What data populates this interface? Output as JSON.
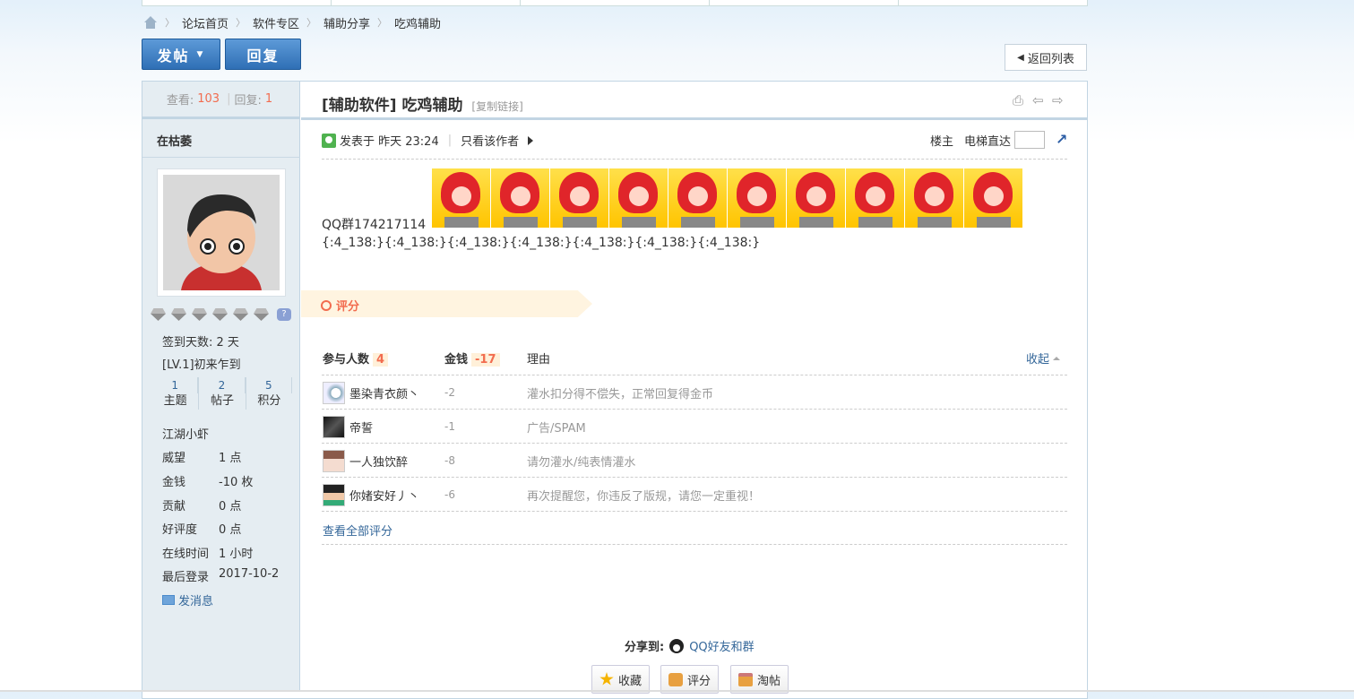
{
  "breadcrumb": [
    "论坛首页",
    "软件专区",
    "辅助分享",
    "吃鸡辅助"
  ],
  "toolbar": {
    "post_label": "发帖",
    "reply_label": "回复",
    "back_label": "返回列表"
  },
  "stats": {
    "views_label": "查看:",
    "views": "103",
    "replies_label": "回复:",
    "replies": "1",
    "divider": "|"
  },
  "user": {
    "name": "在枯萎",
    "signin": "签到天数: 2 天",
    "level": "[LV.1]初来乍到",
    "counts": [
      {
        "value": "1",
        "label": "主题"
      },
      {
        "value": "2",
        "label": "帖子"
      },
      {
        "value": "5",
        "label": "积分"
      }
    ],
    "rank": "江湖小虾",
    "fields": [
      {
        "k": "威望",
        "v": "1 点"
      },
      {
        "k": "金钱",
        "v": "-10 枚"
      },
      {
        "k": "贡献",
        "v": "0 点"
      },
      {
        "k": "好评度",
        "v": "0 点"
      },
      {
        "k": "在线时间",
        "v": "1 小时"
      },
      {
        "k": "最后登录",
        "v": "2017-10-2"
      }
    ],
    "send_msg": "发消息",
    "help_mark": "?"
  },
  "post": {
    "title": "[辅助软件] 吃鸡辅助",
    "copy_link": "[复制链接]",
    "posted": "发表于 昨天 23:24",
    "only_author": "只看该作者",
    "floor": "楼主",
    "elevator": "电梯直达",
    "go_icon": "↗",
    "body_qq": "QQ群174217114",
    "body_codes": "{:4_138:}{:4_138:}{:4_138:}{:4_138:}{:4_138:}{:4_138:}{:4_138:}",
    "icons": {
      "print": "⎙",
      "prev": "⇦",
      "next": "⇨"
    }
  },
  "rating": {
    "label": "评分",
    "col_people": "参与人数",
    "people": "4",
    "col_money": "金钱",
    "money": "-17",
    "col_reason": "理由",
    "collapse": "收起",
    "rows": [
      {
        "name": "墨染青衣颜丶",
        "score": "-2",
        "reason": "灌水扣分得不偿失，正常回复得金币"
      },
      {
        "name": "帝誓",
        "score": "-1",
        "reason": "广告/SPAM"
      },
      {
        "name": "一人独饮醉",
        "score": "-8",
        "reason": "请勿灌水/纯表情灌水"
      },
      {
        "name": "你媎安好丿丶",
        "score": "-6",
        "reason": "再次提醒您，你违反了版规，请您一定重视！"
      }
    ],
    "view_all": "查看全部评分"
  },
  "share": {
    "label": "分享到:",
    "qq": "QQ好友和群"
  },
  "actions": {
    "fav": "收藏",
    "rate": "评分",
    "tao": "淘帖"
  }
}
